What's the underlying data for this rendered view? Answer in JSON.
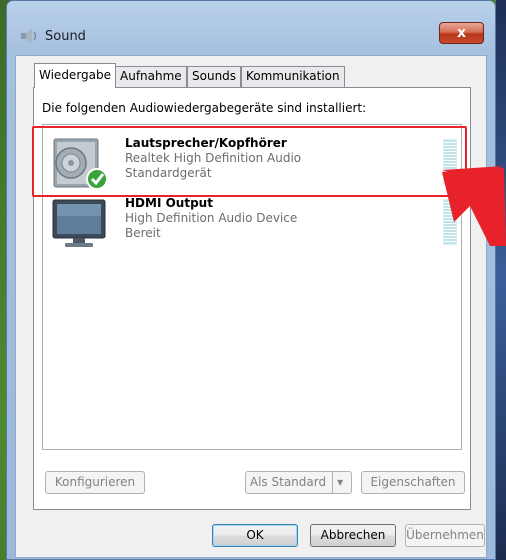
{
  "window": {
    "title": "Sound",
    "close_label": "x"
  },
  "tabs": [
    {
      "label": "Wiedergabe",
      "active": true
    },
    {
      "label": "Aufnahme"
    },
    {
      "label": "Sounds"
    },
    {
      "label": "Kommunikation"
    }
  ],
  "panel": {
    "heading": "Die folgenden Audiowiedergabegeräte sind installiert:"
  },
  "devices": [
    {
      "name": "Lautsprecher/Kopfhörer",
      "driver": "Realtek High Definition Audio",
      "status": "Standardgerät",
      "icon": "speaker-icon",
      "default": true
    },
    {
      "name": "HDMI Output",
      "driver": "High Definition Audio Device",
      "status": "Bereit",
      "icon": "monitor-icon"
    }
  ],
  "buttons": {
    "configure": "Konfigurieren",
    "set_default": "Als Standard",
    "properties": "Eigenschaften",
    "ok": "OK",
    "cancel": "Abbrechen",
    "apply": "Übernehmen"
  },
  "colors": {
    "highlight": "#e8222a",
    "arrow": "#e8222a",
    "check": "#3aa43a"
  }
}
